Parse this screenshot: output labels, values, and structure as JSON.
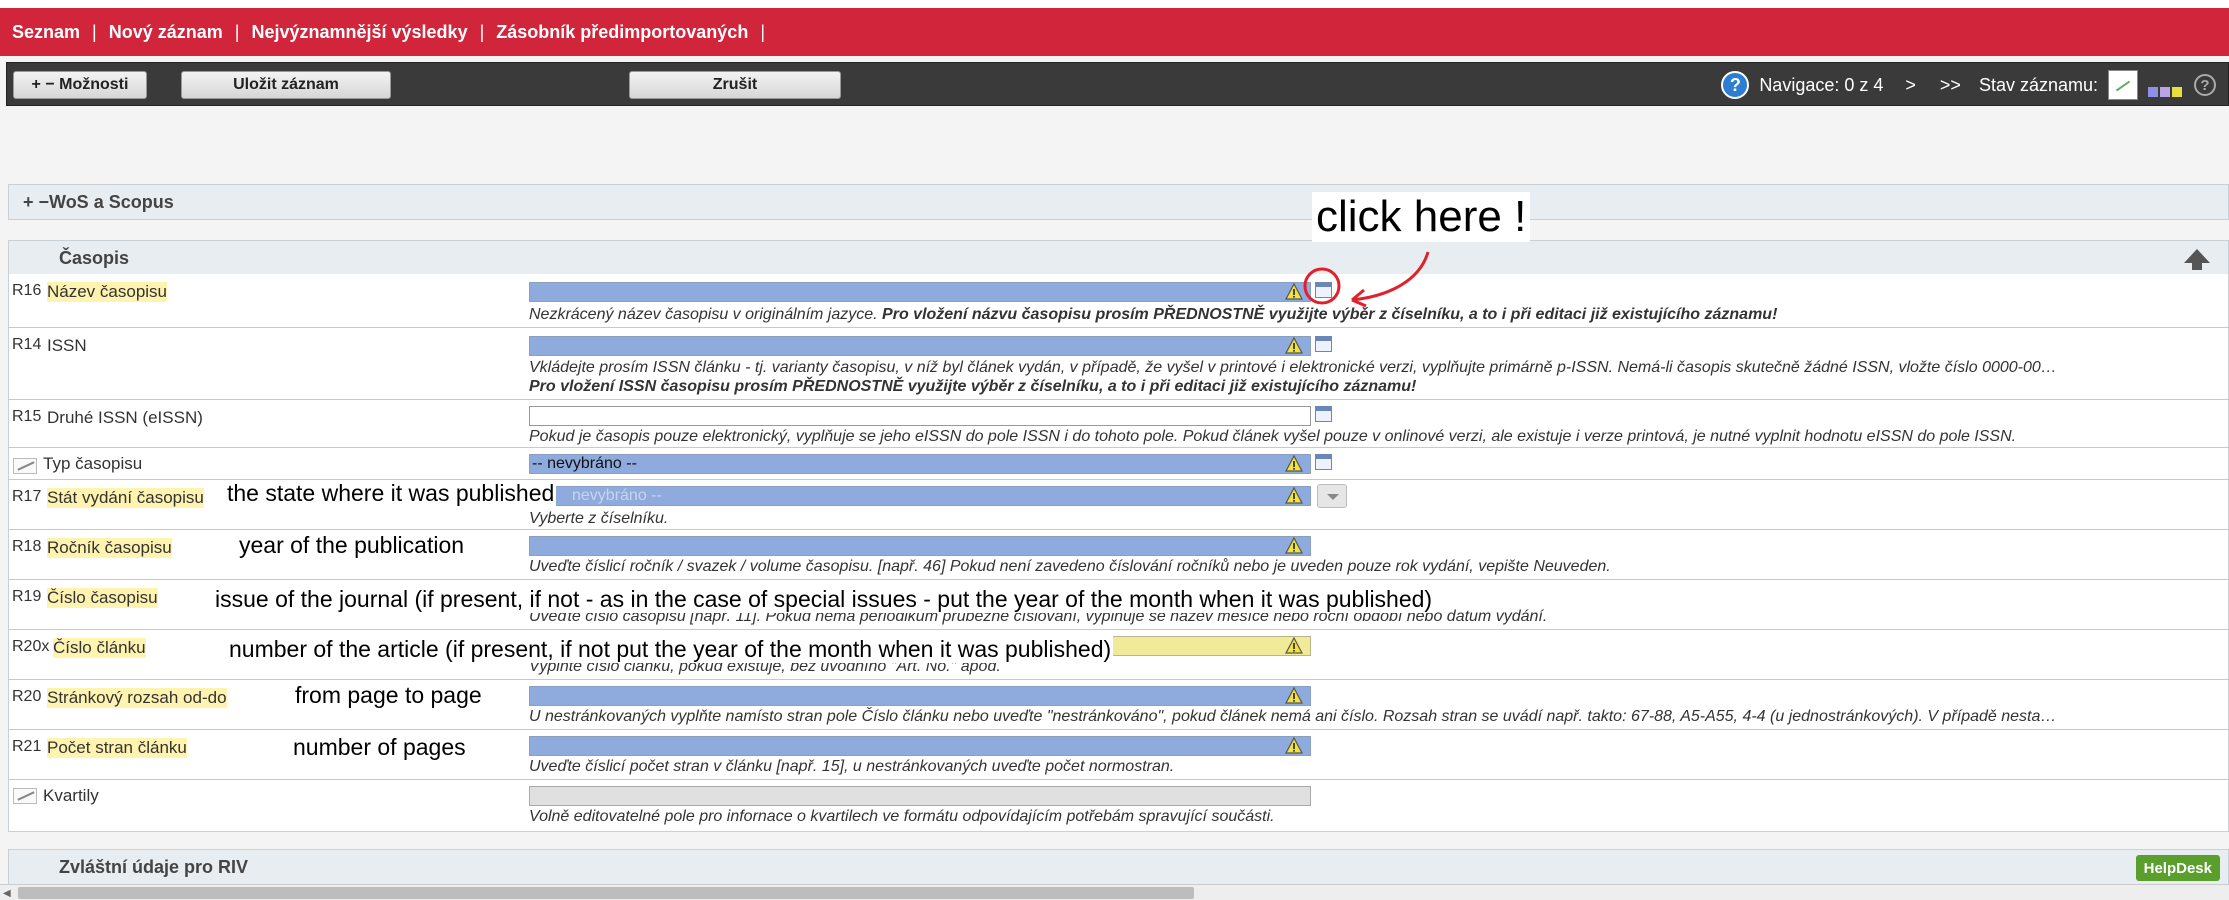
{
  "topnav": {
    "items": [
      "Seznam",
      "Nový záznam",
      "Nejvýznamnější výsledky",
      "Zásobník předimportovaných"
    ],
    "separator": "|"
  },
  "toolbar": {
    "options_label": "+ − Možnosti",
    "save_label": "Uložit záznam",
    "cancel_label": "Zrušit",
    "help_glyph": "?",
    "navigation_text": "Navigace: 0 z 4",
    "next": ">",
    "last": ">>",
    "status_label": "Stav záznamu:",
    "help_glyph_right": "?",
    "status_colors": [
      "#8f8fe8",
      "#b9a4e8",
      "#e8e03a"
    ]
  },
  "sections": {
    "wos": "+ −WoS a Scopus",
    "casopis": "Časopis",
    "riv": "Zvláštní údaje pro RIV"
  },
  "callout": {
    "text": "click here !"
  },
  "rows": [
    {
      "code": "R16",
      "label": "Název časopisu",
      "hint": "Nezkrácený název časopisu v originálním jazyce. ",
      "hint_bold": "Pro vložení názvu časopisu prosím PŘEDNOSTNĚ využijte výběr z číselníku, a to i při editaci již existujícího záznamu!"
    },
    {
      "code": "R14",
      "label": "ISSN",
      "hint": "Vkládejte prosím ISSN článku - tj. varianty časopisu, v níž byl článek vydán, v případě, že vyšel v printové i elektronické verzi, vyplňujte primárně p-ISSN. Nemá-li časopis skutečně žádné ISSN, vložte číslo 0000-00…",
      "hint_bold": "Pro vložení ISSN časopisu prosím PŘEDNOSTNĚ využijte výběr z číselníku, a to i při editaci již existujícího záznamu!"
    },
    {
      "code": "R15",
      "label": "Druhé ISSN (eISSN)",
      "hint": "Pokud je časopis pouze elektronický, vyplňuje se jeho eISSN do pole ISSN i do tohoto pole. Pokud článek vyšel pouze v onlinové verzi, ale existuje i verze printová, je nutné vyplnit hodnotu eISSN do pole ISSN."
    },
    {
      "label": "Typ časopisu",
      "value": "-- nevybráno --"
    },
    {
      "code": "R17",
      "label": "Stát vydání časopisu",
      "value": "nevybráno --",
      "annotation": "the state where it was published",
      "hint": "Vyberte z číselníku."
    },
    {
      "code": "R18",
      "label": "Ročník časopisu",
      "annotation": "year of the publication",
      "hint": "Uveďte číslicí ročník / svazek / volume časopisu. [např. 46] Pokud není zavedeno číslování ročníků nebo je uveden pouze rok vydání, vepište Neuveden."
    },
    {
      "code": "R19",
      "label": "Číslo časopisu",
      "annotation": "issue of the journal (if present, if not - as in the case of special issues - put the year of the month when it was published)",
      "hint": "Uveďte číslo časopisu [např. 11]. Pokud nemá periodikum průběžné číslování, vyplňuje se název měsíce nebo roční období nebo datum vydání."
    },
    {
      "code": "R20x",
      "label": "Číslo článku",
      "annotation": "number of the article (if present, if not put the year of the month when it was published)",
      "hint": "Vyplňte číslo článku, pokud existuje, bez úvodního \"Art. No.\" apod."
    },
    {
      "code": "R20",
      "label": "Stránkový rozsah od-do",
      "annotation": "from page to page",
      "hint": "U nestránkovaných vyplňte namísto stran pole Číslo článku nebo uveďte \"nestránkováno\", pokud článek nemá ani číslo. Rozsah stran se uvádí např. takto: 67-88, A5-A55, 4-4 (u jednostránkových). V případě nesta…"
    },
    {
      "code": "R21",
      "label": "Počet stran článku",
      "annotation": "number of pages",
      "hint": "Uveďte číslicí počet stran v článku [např. 15], u nestránkovaných uveďte počet normostran."
    },
    {
      "label": "Kvartily",
      "hint": "Volně editovatelné pole pro infornace o kvartilech ve formátu odpovídajícím potřebám spravující součásti."
    }
  ],
  "helpdesk_label": "HelpDesk",
  "scroll_left_glyph": "◀"
}
